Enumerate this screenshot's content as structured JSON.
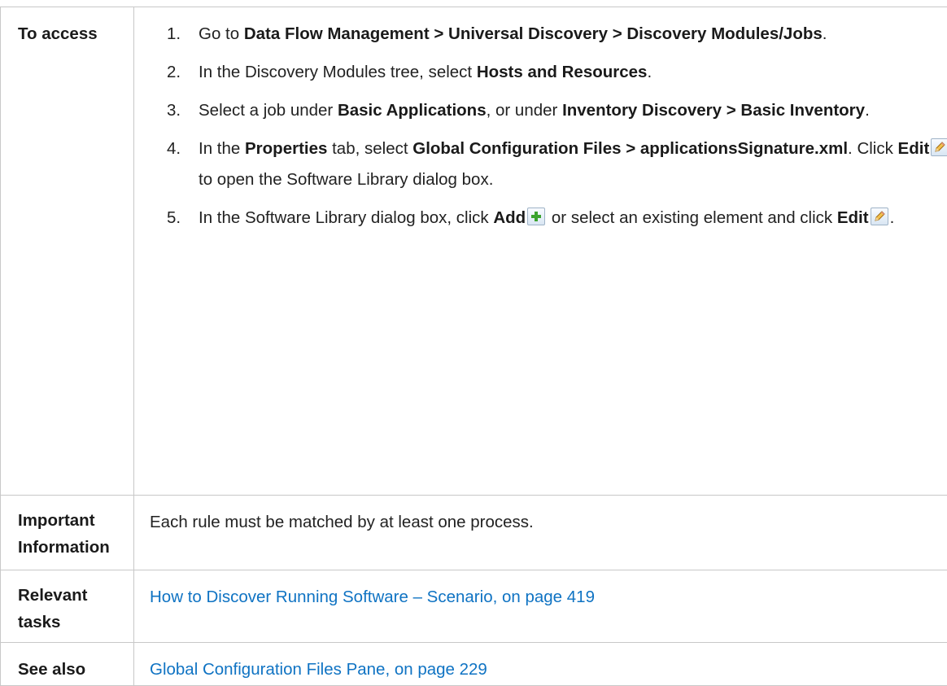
{
  "rows": {
    "access": {
      "label": "To access",
      "steps": [
        {
          "num": "1.",
          "t1": "Go to ",
          "b1": "Data Flow Management > Universal Discovery > Discovery Modules/Jobs",
          "t2": "."
        },
        {
          "num": "2.",
          "t1": "In the Discovery Modules tree, select ",
          "b1": "Hosts and Resources",
          "t2": "."
        },
        {
          "num": "3.",
          "t1": "Select a job under ",
          "b1": "Basic Applications",
          "t2": ", or under ",
          "b2": "Inventory Discovery > Basic Inventory",
          "t3": "."
        },
        {
          "num": "4.",
          "t1": "In the ",
          "b1": "Properties",
          "t2": " tab, select ",
          "b2": "Global Configuration Files > applicationsSignature.xml",
          "t3": ". Click ",
          "b3": "Edit",
          "t4": " to open the Software Library dialog box."
        },
        {
          "num": "5.",
          "t1": "In the Software Library dialog box, click ",
          "b1": "Add",
          "t2": " or select an existing element and click ",
          "b2": "Edit",
          "t3": "."
        }
      ]
    },
    "important": {
      "label_line1": "Important",
      "label_line2": "Information",
      "text": "Each rule must be matched by at least one process."
    },
    "relevant": {
      "label_line1": "Relevant",
      "label_line2": "tasks",
      "link": "How to Discover Running Software – Scenario, on page 419"
    },
    "see_also": {
      "label": "See also",
      "link": "Global Configuration Files Pane, on page 229"
    }
  },
  "icons": {
    "edit": "pencil-edit-icon",
    "add": "green-plus-add-icon"
  },
  "colors": {
    "link": "#0f73c3",
    "border": "#c8c8c8",
    "add_icon": "#3aa22e"
  }
}
